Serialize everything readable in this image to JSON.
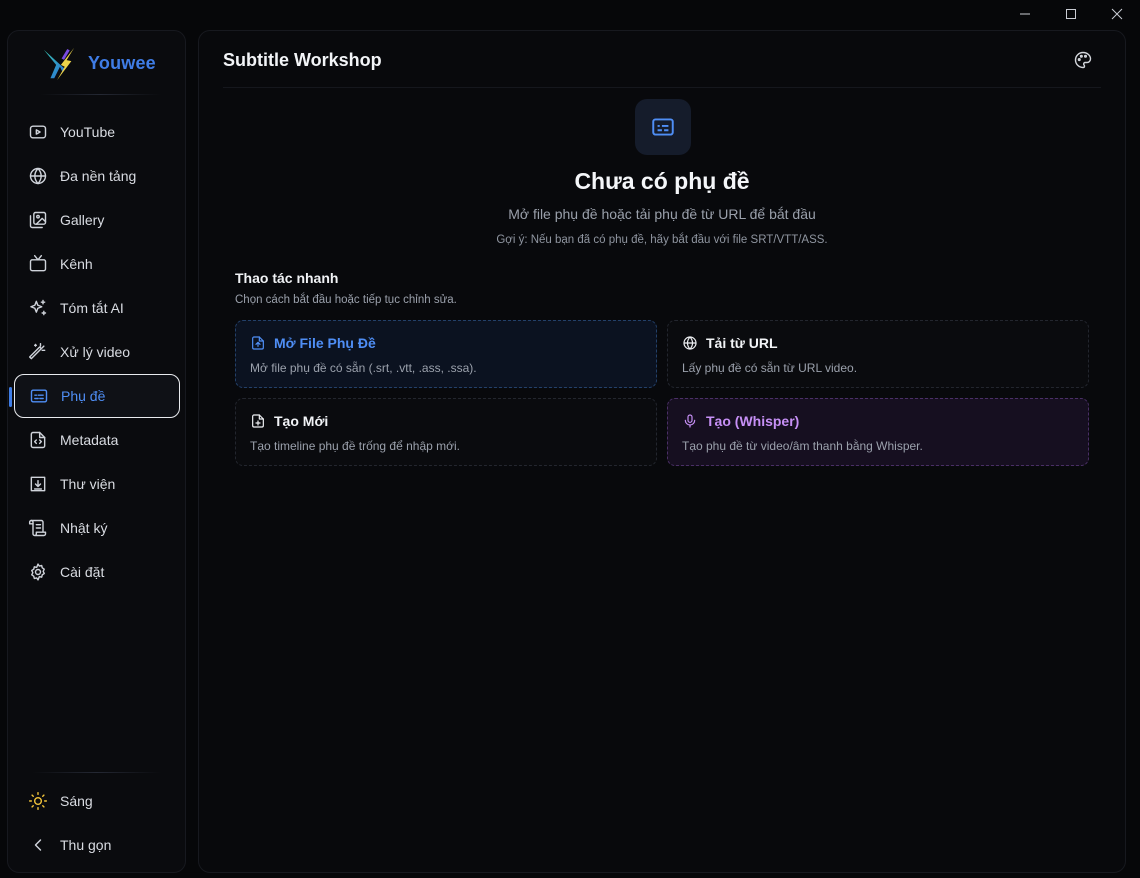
{
  "window": {
    "controls": [
      "minimize-icon",
      "maximize-icon",
      "close-icon"
    ]
  },
  "brand": {
    "name": "Youwee"
  },
  "sidebar": {
    "items": [
      {
        "label": "YouTube",
        "icon": "youtube-icon"
      },
      {
        "label": "Đa nền tảng",
        "icon": "globe-icon"
      },
      {
        "label": "Gallery",
        "icon": "gallery-icon"
      },
      {
        "label": "Kênh",
        "icon": "tv-icon"
      },
      {
        "label": "Tóm tắt AI",
        "icon": "sparkles-icon"
      },
      {
        "label": "Xử lý video",
        "icon": "magic-wand-icon"
      },
      {
        "label": "Phụ đề",
        "icon": "captions-icon",
        "active": true
      },
      {
        "label": "Metadata",
        "icon": "file-code-icon"
      },
      {
        "label": "Thư viện",
        "icon": "folder-download-icon"
      },
      {
        "label": "Nhật ký",
        "icon": "scroll-icon"
      },
      {
        "label": "Cài đặt",
        "icon": "gear-icon"
      }
    ],
    "bottom": [
      {
        "label": "Sáng",
        "icon": "sun-icon"
      },
      {
        "label": "Thu gọn",
        "icon": "chevron-left-icon"
      }
    ]
  },
  "main": {
    "title": "Subtitle Workshop",
    "empty": {
      "title": "Chưa có phụ đề",
      "subtitle": "Mở file phụ đề hoặc tải phụ đề từ URL để bắt đầu",
      "hint": "Gợi ý: Nếu bạn đã có phụ đề, hãy bắt đầu với file SRT/VTT/ASS."
    },
    "quick_actions": {
      "title": "Thao tác nhanh",
      "subtitle": "Chọn cách bắt đầu hoặc tiếp tục chỉnh sửa.",
      "cards": [
        {
          "title": "Mở File Phụ Đề",
          "desc": "Mở file phụ đề có sẵn (.srt, .vtt, .ass, .ssa).",
          "icon": "file-upload-icon"
        },
        {
          "title": "Tải từ URL",
          "desc": "Lấy phụ đề có sẵn từ URL video.",
          "icon": "globe-icon"
        },
        {
          "title": "Tạo Mới",
          "desc": "Tạo timeline phụ đề trống để nhập mới.",
          "icon": "file-plus-icon"
        },
        {
          "title": "Tạo (Whisper)",
          "desc": "Tạo phụ đề từ video/âm thanh bằng Whisper.",
          "icon": "microphone-icon"
        }
      ]
    }
  },
  "colors": {
    "accent": "#4f8ef5",
    "brand": "#3f7de6",
    "whisper": "#c790f6"
  }
}
